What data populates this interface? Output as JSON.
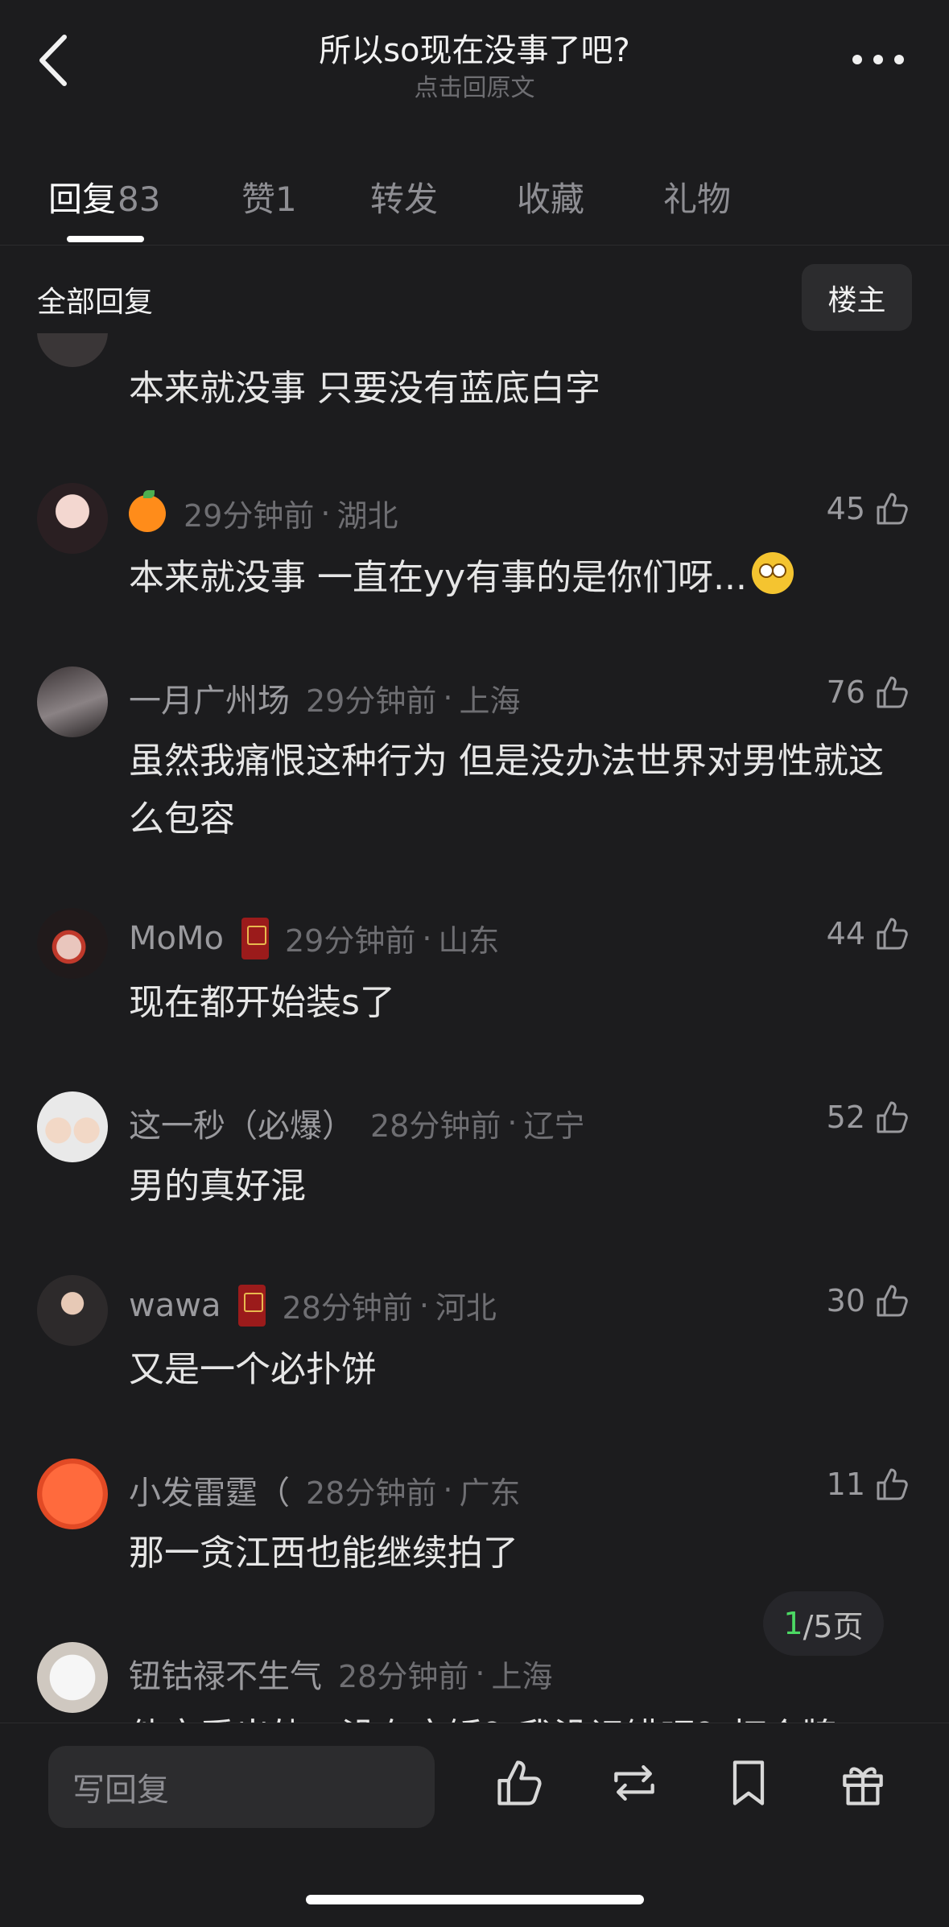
{
  "header": {
    "title": "所以so现在没事了吧?",
    "subtitle": "点击回原文"
  },
  "tabs": [
    {
      "label": "回复",
      "count": "83"
    },
    {
      "label": "赞1"
    },
    {
      "label": "转发"
    },
    {
      "label": "收藏"
    },
    {
      "label": "礼物"
    }
  ],
  "section": {
    "title": "全部回复",
    "op_button": "楼主"
  },
  "partial_comment": {
    "text": "本来就没事 只要没有蓝底白字"
  },
  "comments": [
    {
      "name": "",
      "time": "29分钟前",
      "location": "湖北",
      "likes": "45",
      "text": "本来就没事 一直在yy有事的是你们呀..."
    },
    {
      "name": "一月广州场",
      "time": "29分钟前",
      "location": "上海",
      "likes": "76",
      "text": "虽然我痛恨这种行为 但是没办法世界对男性就这么包容"
    },
    {
      "name": "MoMo",
      "time": "29分钟前",
      "location": "山东",
      "likes": "44",
      "text": "现在都开始装s了"
    },
    {
      "name": "这一秒（必爆）",
      "time": "28分钟前",
      "location": "辽宁",
      "likes": "52",
      "text": "男的真好混"
    },
    {
      "name": "wawa",
      "time": "28分钟前",
      "location": "河北",
      "likes": "30",
      "text": "又是一个必扑饼"
    },
    {
      "name": "小发雷霆（",
      "time": "28分钟前",
      "location": "广东",
      "likes": "11",
      "text": "那一贪江西也能继续拍了"
    },
    {
      "name": "钮钴禄不生气",
      "time": "28分钟前",
      "location": "上海",
      "likes": "",
      "text": "他恋爱出轨，没有实锤？我没记错吧？打个牌"
    }
  ],
  "dot": "·",
  "pagination": {
    "current": "1",
    "total": "/5页"
  },
  "bottom": {
    "reply_placeholder": "写回复"
  },
  "icons": {
    "back": "chevron-left-icon",
    "more": "more-dots-icon",
    "like": "thumb-up-icon",
    "repost": "repost-icon",
    "bookmark": "bookmark-icon",
    "gift": "gift-icon"
  },
  "colors": {
    "background": "#1c1c1e",
    "accent_page": "#4cd964"
  }
}
